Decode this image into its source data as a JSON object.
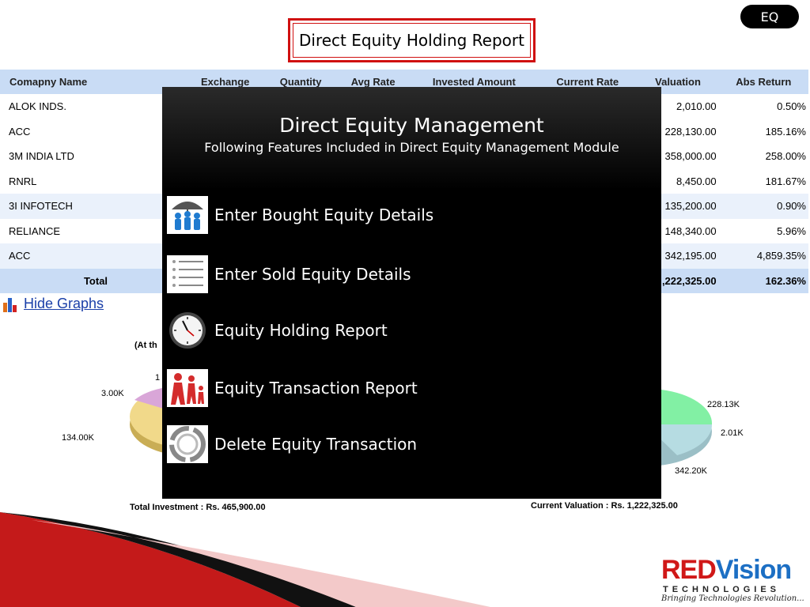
{
  "badge": "EQ",
  "report_title": "Direct Equity Holding Report",
  "table": {
    "columns": [
      "Comapny Name",
      "Exchange",
      "Quantity",
      "Avg Rate",
      "Invested Amount",
      "Current Rate",
      "Valuation",
      "Abs Return"
    ],
    "rows": [
      {
        "name": "ALOK INDS.",
        "valuation": "2,010.00",
        "abs_return": "0.50%"
      },
      {
        "name": "ACC",
        "valuation": "228,130.00",
        "abs_return": "185.16%"
      },
      {
        "name": "3M INDIA LTD",
        "valuation": "358,000.00",
        "abs_return": "258.00%"
      },
      {
        "name": "RNRL",
        "valuation": "8,450.00",
        "abs_return": "181.67%"
      },
      {
        "name": "3I INFOTECH",
        "valuation": "135,200.00",
        "abs_return": "0.90%"
      },
      {
        "name": "RELIANCE",
        "valuation": "148,340.00",
        "abs_return": "5.96%"
      },
      {
        "name": "ACC",
        "valuation": "342,195.00",
        "abs_return": "4,859.35%"
      }
    ],
    "total": {
      "label": "Total",
      "valuation": ",222,325.00",
      "abs_return": "162.36%"
    }
  },
  "hide_graphs": "Hide Graphs",
  "charts": {
    "left_caption_partial": "(At th",
    "left_labels": {
      "a": "3.00K",
      "b": "134.00K",
      "c": "1"
    },
    "right_labels": {
      "a": "228.13K",
      "b": "2.01K",
      "c": "342.20K"
    },
    "total_investment": "Total Investment : Rs. 465,900.00",
    "current_valuation": "Current Valuation : Rs. 1,222,325.00"
  },
  "overlay": {
    "title": "Direct Equity Management",
    "subtitle": "Following Features Included in Direct Equity Management Module",
    "features": [
      {
        "label": "Enter Bought Equity Details",
        "icon": "people-umbrella-icon"
      },
      {
        "label": "Enter Sold Equity Details",
        "icon": "list-icon"
      },
      {
        "label": "Equity Holding Report",
        "icon": "clock-icon"
      },
      {
        "label": "Equity Transaction Report",
        "icon": "family-icon"
      },
      {
        "label": "Delete Equity Transaction",
        "icon": "recycle-icon"
      }
    ]
  },
  "logo": {
    "red": "RED",
    "vision": "Vision",
    "technologies": "TECHNOLOGIES",
    "tagline": "Bringing Technologies Revolution..."
  },
  "colors": {
    "accent_red": "#d01010",
    "header_blue": "#c9dcf5",
    "link_blue": "#1a3fa8",
    "logo_blue": "#1c6fc4"
  }
}
